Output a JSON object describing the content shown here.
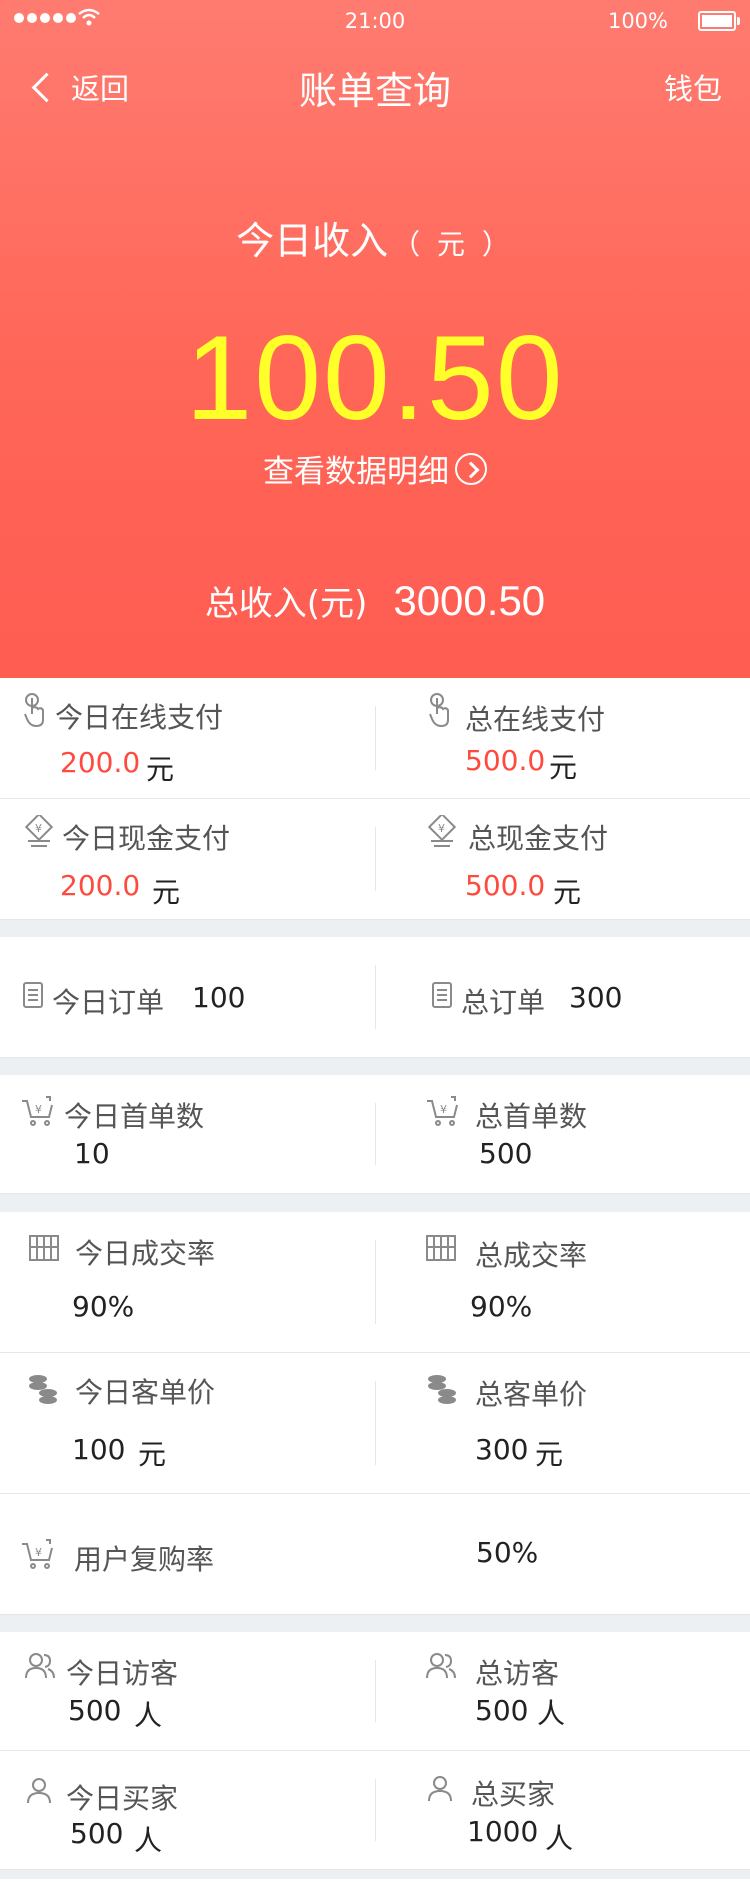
{
  "status_bar": {
    "time": "21:00",
    "battery": "100%"
  },
  "nav": {
    "back_label": "返回",
    "title": "账单查询",
    "wallet_label": "钱包"
  },
  "summary": {
    "today_income_label": "今日收入",
    "today_income_unit": "（ 元 ）",
    "today_income_value": "100.50",
    "detail_link_label": "查看数据明细",
    "total_income_label": "总收入(元)",
    "total_income_value": "3000.50"
  },
  "online_pay": {
    "today_label": "今日在线支付",
    "today_value": "200.0",
    "total_label": "总在线支付",
    "total_value": "500.0",
    "unit": "元"
  },
  "cash_pay": {
    "today_label": "今日现金支付",
    "today_value": "200.0",
    "total_label": "总现金支付",
    "total_value": "500.0",
    "unit": "元"
  },
  "orders": {
    "today_label": "今日订单",
    "today_value": "100",
    "total_label": "总订单",
    "total_value": "300"
  },
  "first_orders": {
    "today_label": "今日首单数",
    "today_value": "10",
    "total_label": "总首单数",
    "total_value": "500"
  },
  "conversion": {
    "today_label": "今日成交率",
    "today_value": "90%",
    "total_label": "总成交率",
    "total_value": "90%"
  },
  "unit_price": {
    "today_label": "今日客单价",
    "today_value": "100",
    "total_label": "总客单价",
    "total_value": "300",
    "unit": "元"
  },
  "repurchase": {
    "label": "用户复购率",
    "value": "50%"
  },
  "visitors": {
    "today_label": "今日访客",
    "today_value": "500",
    "total_label": "总访客",
    "total_value": "500",
    "unit": "人"
  },
  "buyers": {
    "today_label": "今日买家",
    "today_value": "500",
    "total_label": "总买家",
    "total_value": "1000",
    "unit": "人"
  },
  "colors": {
    "header_top": "#ff7b70",
    "header_bottom": "#ff5c52",
    "amount": "#ffff2a",
    "accent_red": "#ff4a3d",
    "gap": "#edf0f3"
  },
  "icons": [
    "hand-pointer-icon",
    "cash-icon",
    "receipt-icon",
    "cart-yen-icon",
    "abacus-icon",
    "coins-icon",
    "users-icon",
    "user-icon"
  ]
}
